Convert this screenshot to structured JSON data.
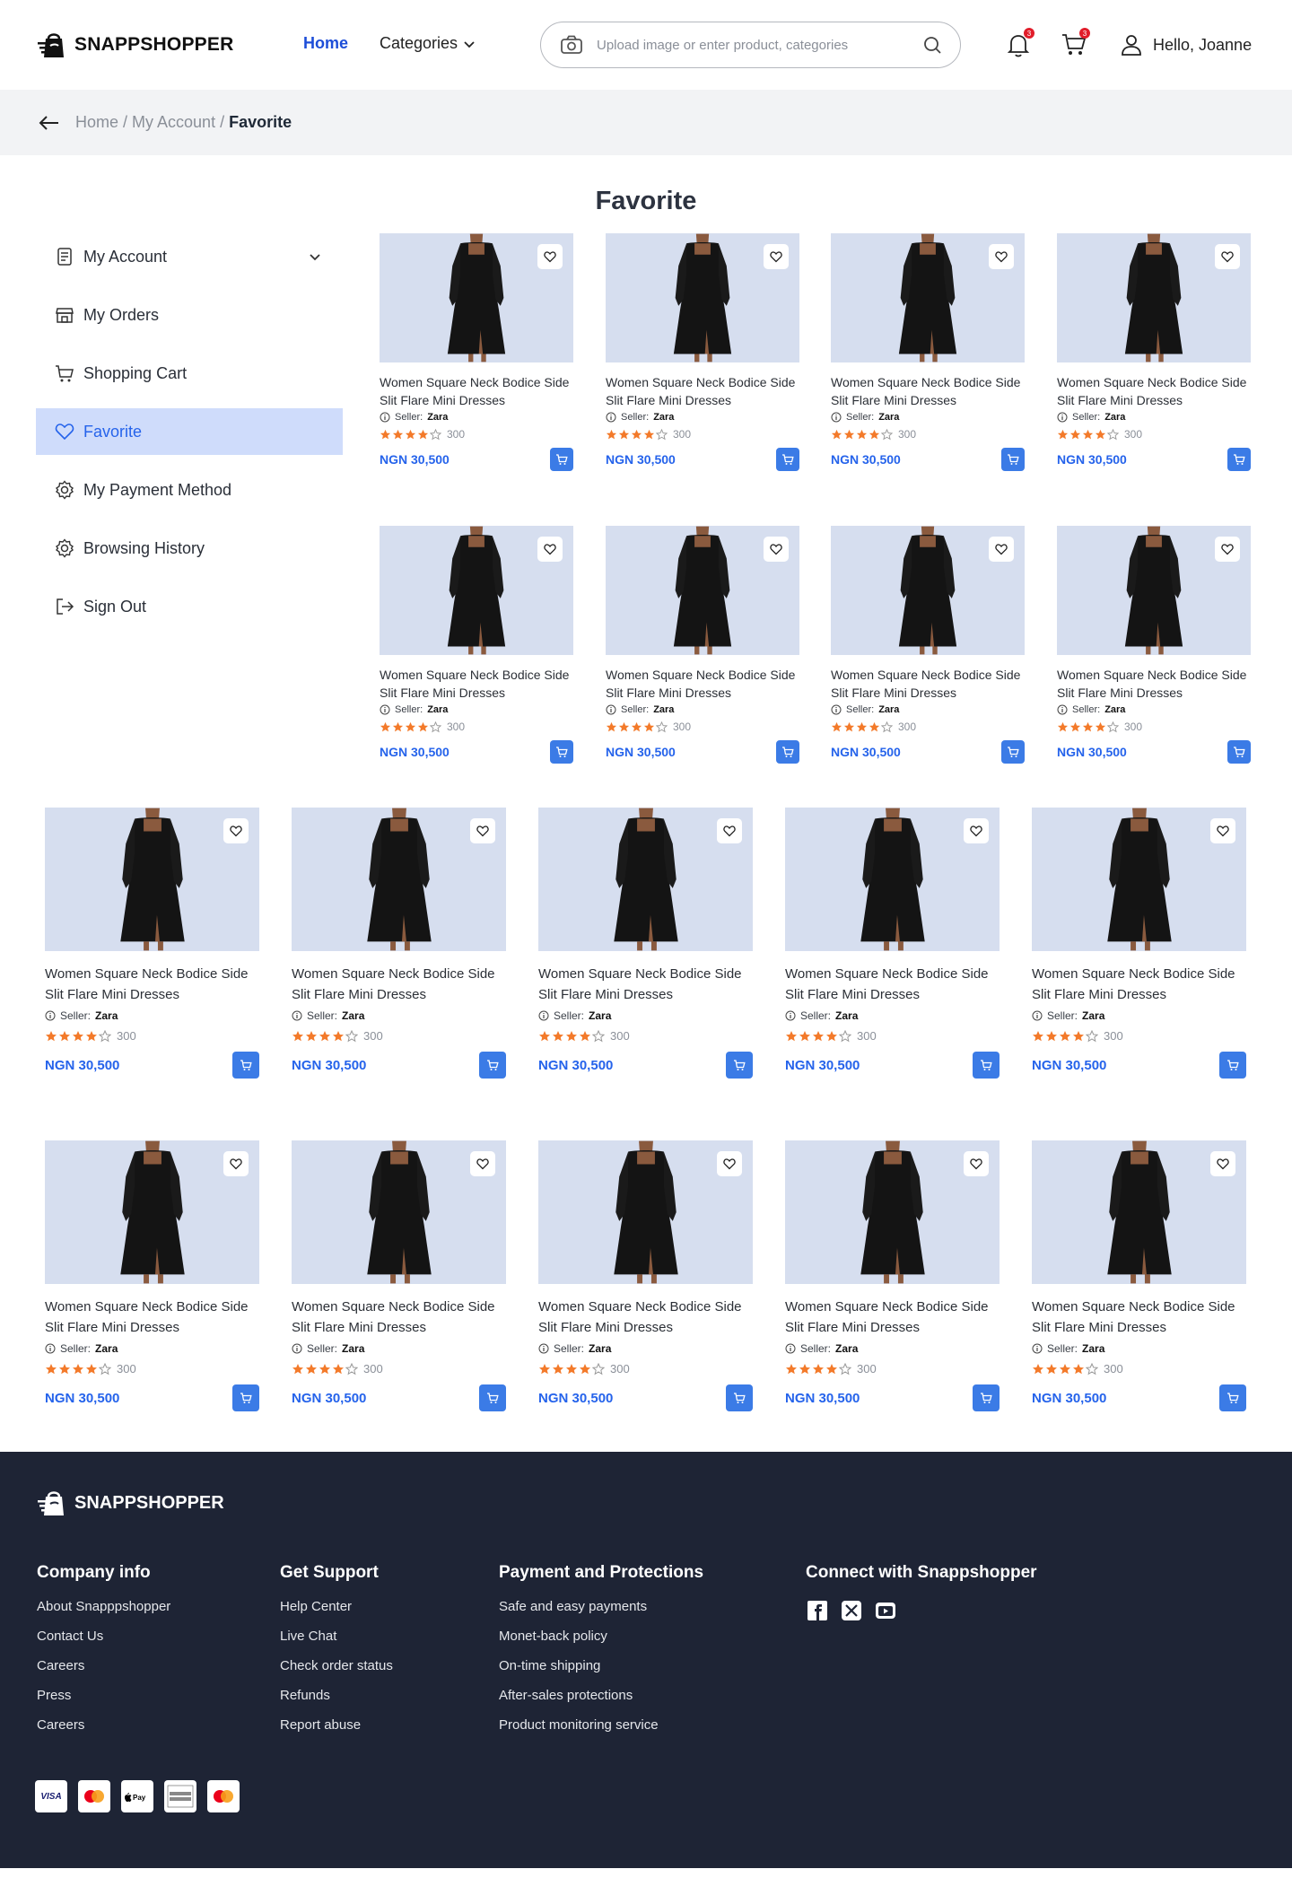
{
  "brand": {
    "name": "SNAPPSHOPPER"
  },
  "nav": {
    "home": "Home",
    "categories": "Categories"
  },
  "search": {
    "placeholder": "Upload image or enter product, categories"
  },
  "header": {
    "notif_count": "3",
    "cart_count": "3",
    "greeting": "Hello, Joanne"
  },
  "breadcrumb": {
    "home": "Home",
    "account": "My Account",
    "current": "Favorite"
  },
  "page": {
    "title": "Favorite"
  },
  "sidebar": {
    "items": [
      {
        "label": "My Account",
        "icon": "account-icon"
      },
      {
        "label": "My Orders",
        "icon": "orders-icon"
      },
      {
        "label": "Shopping Cart",
        "icon": "cart-icon"
      },
      {
        "label": "Favorite",
        "icon": "heart-icon",
        "active": true
      },
      {
        "label": "My Payment Method",
        "icon": "gear-icon"
      },
      {
        "label": "Browsing History",
        "icon": "gear-icon"
      },
      {
        "label": "Sign Out",
        "icon": "signout-icon"
      }
    ]
  },
  "product": {
    "name": "Women Square Neck Bodice Side Slit Flare Mini Dresses",
    "seller_label": "Seller:",
    "seller": "Zara",
    "rating": 4,
    "rating_count": "300",
    "price": "NGN 30,500"
  },
  "colors": {
    "accent": "#2563eb",
    "active_bg": "#cfdcfb",
    "star": "#f37a2a",
    "footer_bg": "#1e2435"
  },
  "footer": {
    "company": {
      "title": "Company info",
      "links": [
        "About Snapppshopper",
        "Contact Us",
        "Careers",
        "Press",
        "Careers"
      ]
    },
    "support": {
      "title": "Get Support",
      "links": [
        "Help Center",
        "Live Chat",
        "Check order status",
        "Refunds",
        "Report abuse"
      ]
    },
    "payment": {
      "title": "Payment and Protections",
      "links": [
        "Safe and easy payments",
        "Monet-back policy",
        "On-time shipping",
        "After-sales protections",
        "Product monitoring service"
      ]
    },
    "connect": {
      "title": "Connect with Snappshopper"
    },
    "pay_methods": {
      "visa": "VISA"
    }
  }
}
